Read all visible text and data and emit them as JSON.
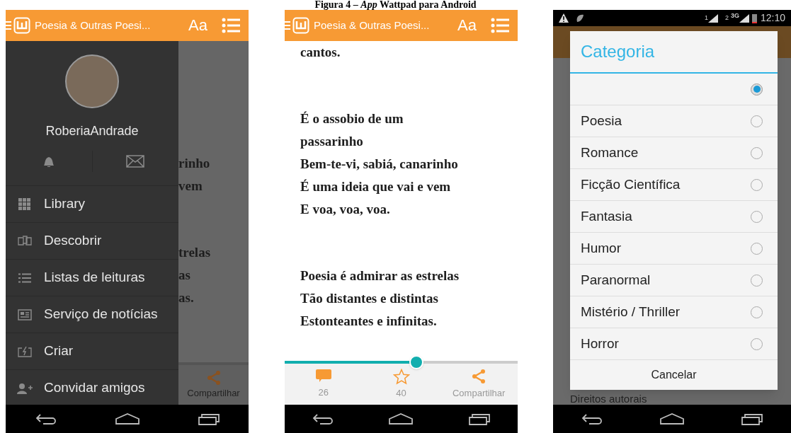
{
  "caption": "Figura 4 – *App* Wattpad para Android",
  "drawer_screen": {
    "header": {
      "title": "Poesia & Outras Poesi...",
      "font_button": "Aa"
    },
    "user": {
      "name": "RoberiaAndrade"
    },
    "menu": [
      {
        "label": "Library"
      },
      {
        "label": "Descobrir"
      },
      {
        "label": "Listas de leituras"
      },
      {
        "label": "Serviço de notícias"
      },
      {
        "label": "Criar"
      },
      {
        "label": "Convidar amigos"
      }
    ],
    "background_lines_top": [
      "rinho",
      "vem"
    ],
    "background_lines_bottom": [
      "trelas",
      "as",
      "as."
    ],
    "background_share": "Compartilhar"
  },
  "reader_screen": {
    "header": {
      "title": "Poesia & Outras Poesi...",
      "font_button": "Aa"
    },
    "stanzas": [
      [
        "cantos."
      ],
      [
        "É o assobio de um",
        "passarinho",
        "Bem-te-vi, sabiá, canarinho",
        "É uma ideia que vai e vem",
        "E voa, voa, voa."
      ],
      [
        "Poesia é admirar as estrelas",
        "Tão distantes e distintas",
        "Estonteantes e infinitas."
      ]
    ],
    "progress": {
      "level": 0.565
    },
    "actions": [
      {
        "kind": "comments",
        "label": "26"
      },
      {
        "kind": "votes",
        "label": "40"
      },
      {
        "kind": "share",
        "label": "Compartilhar"
      }
    ]
  },
  "category_screen": {
    "status_bar": {
      "sim1": "1",
      "sim2": "2",
      "network": "3G",
      "time": "12:10"
    },
    "dialog": {
      "title": "Categoria",
      "options": [
        {
          "selected": true
        },
        {
          "label": "Poesia",
          "selected": false
        },
        {
          "label": "Romance",
          "selected": false
        },
        {
          "label": "Ficção Científica",
          "selected": false
        },
        {
          "label": "Fantasia",
          "selected": false
        },
        {
          "label": "Humor",
          "selected": false
        },
        {
          "label": "Paranormal",
          "selected": false
        },
        {
          "label": "Mistério / Thriller",
          "selected": false
        },
        {
          "label": "Horror",
          "selected": false
        }
      ],
      "cancel": "Cancelar"
    },
    "background_text": "Direitos autorais"
  }
}
